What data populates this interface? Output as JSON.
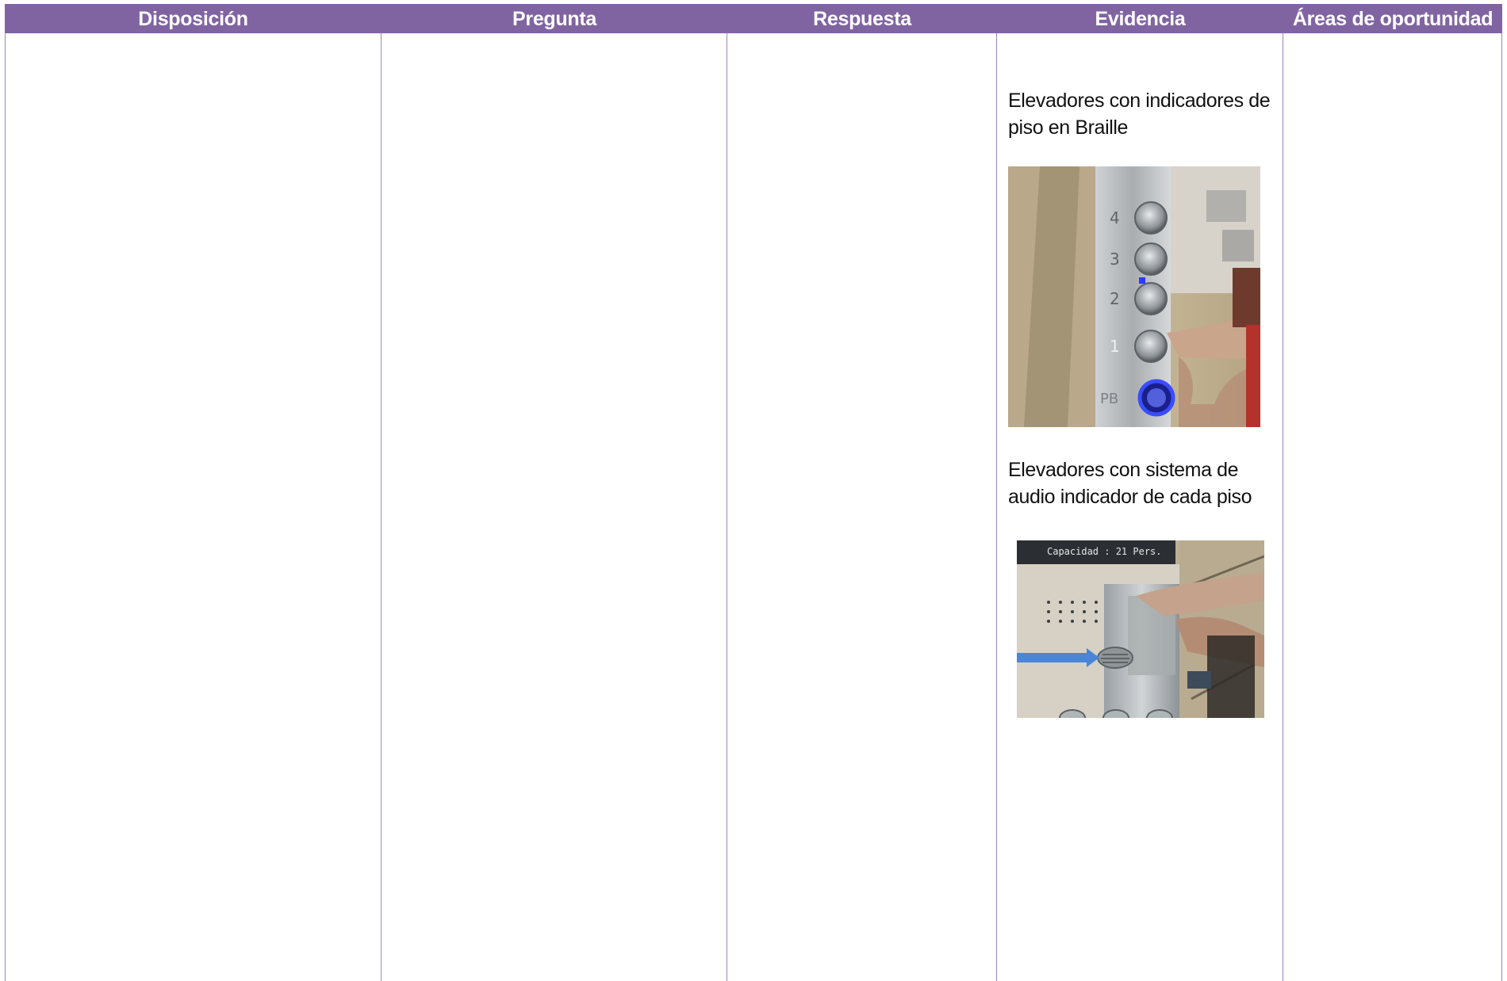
{
  "table": {
    "headers": [
      "Disposición",
      "Pregunta",
      "Respuesta",
      "Evidencia",
      "Áreas de oportunidad"
    ]
  },
  "evidence": {
    "caption_1": "Elevadores con indicadores de piso en Braille",
    "caption_2": "Elevadores con sistema de audio indicador de cada piso",
    "photo_1_floor_labels": [
      "4",
      "3",
      "2",
      "1",
      "PB"
    ],
    "photo_2_sign_text": "Capacidad : 21 Pers."
  },
  "colors": {
    "header_bg": "#8064a2",
    "header_text": "#ffffff",
    "grid_line": "#9b86bd",
    "button_glow": "#2a3cff",
    "arrow": "#4a86d8"
  }
}
